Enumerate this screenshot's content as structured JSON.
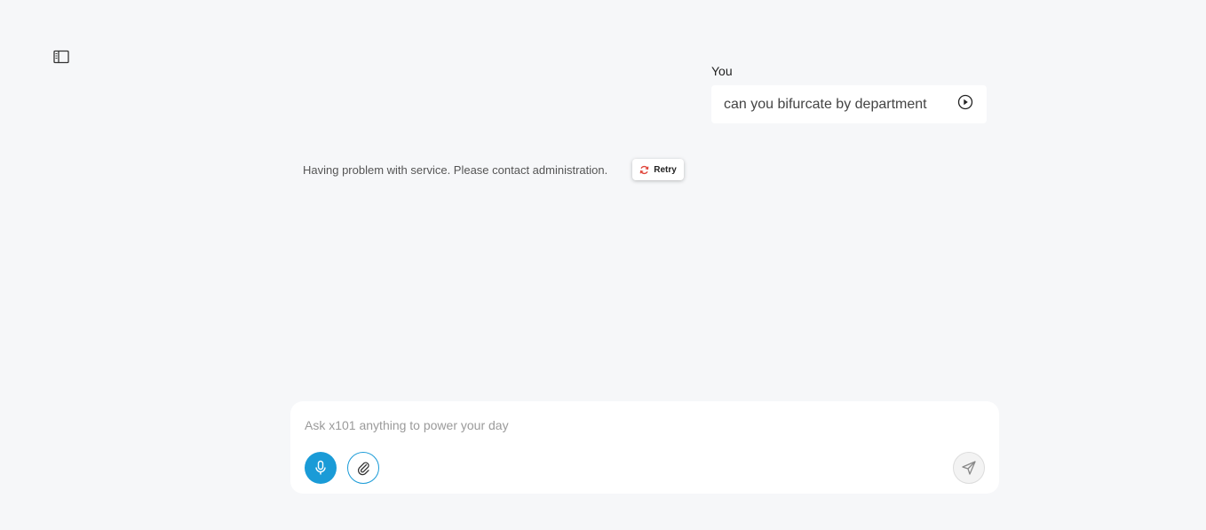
{
  "header": {
    "sidebar_toggle_icon": "sidebar-panel-icon"
  },
  "conversation": {
    "user_message": {
      "author": "You",
      "text": "can you bifurcate by department",
      "action_icon": "play-circle-icon"
    },
    "bot_message": {
      "text": "Having problem with service. Please contact administration.",
      "retry_label": "Retry",
      "retry_icon": "refresh-icon"
    }
  },
  "composer": {
    "placeholder": "Ask x101 anything to power your day",
    "value": "",
    "mic_icon": "microphone-icon",
    "attach_icon": "paperclip-icon",
    "send_icon": "send-icon"
  },
  "colors": {
    "background": "#f6f7f9",
    "accent": "#1a9bd7",
    "retry_icon": "#e0453a"
  }
}
